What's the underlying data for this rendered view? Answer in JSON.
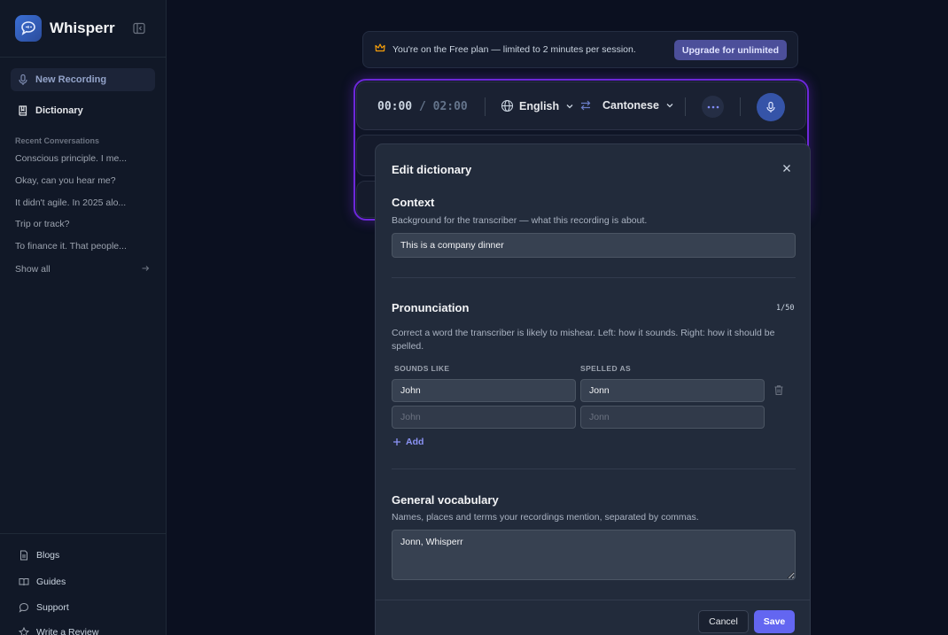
{
  "app": {
    "name": "Whisperr"
  },
  "sidebar": {
    "nav": [
      {
        "label": "New Recording",
        "icon": "mic-icon"
      },
      {
        "label": "Dictionary",
        "icon": "book-icon"
      }
    ],
    "recent_heading": "Recent Conversations",
    "recent": [
      "Conscious principle. I me...",
      "Okay, can you hear me?",
      "It didn't agile. In 2025 alo...",
      "Trip or track?",
      "To finance it. That people..."
    ],
    "show_all": "Show all",
    "footer": [
      {
        "label": "Blogs",
        "icon": "document-icon"
      },
      {
        "label": "Guides",
        "icon": "open-book-icon"
      },
      {
        "label": "Support",
        "icon": "chat-bubble-icon"
      },
      {
        "label": "Write a Review",
        "icon": "star-icon"
      }
    ]
  },
  "banner": {
    "icon": "crown-icon",
    "text": "You're on the Free plan — limited to 2 minutes per session.",
    "button": "Upgrade for unlimited"
  },
  "recorder": {
    "elapsed": "00:00",
    "separator": "/",
    "limit": "02:00",
    "source_lang": "English",
    "target_lang": "Cantonese"
  },
  "dictionary_modal": {
    "title": "Edit dictionary",
    "context": {
      "title": "Context",
      "description": "Background for the transcriber — what this recording is about.",
      "value": "This is a company dinner"
    },
    "pronunciation": {
      "title": "Pronunciation",
      "counter": "1/50",
      "description": "Correct a word the transcriber is likely to mishear. Left: how it sounds. Right: how it should be spelled.",
      "col_sounds": "SOUNDS LIKE",
      "col_spelled": "SPELLED AS",
      "rows": [
        {
          "sounds": "John",
          "spelled": "Jonn"
        }
      ],
      "placeholder_sounds": "John",
      "placeholder_spelled": "Jonn",
      "add_label": "Add"
    },
    "vocabulary": {
      "title": "General vocabulary",
      "description": "Names, places and terms your recordings mention, separated by commas.",
      "value": "Jonn, Whisperr"
    },
    "cancel": "Cancel",
    "save": "Save"
  },
  "colors": {
    "accent": "#6366f1",
    "glow": "#6d28d9",
    "mic": "#3554a8",
    "upgrade": "#4c4f9a"
  }
}
